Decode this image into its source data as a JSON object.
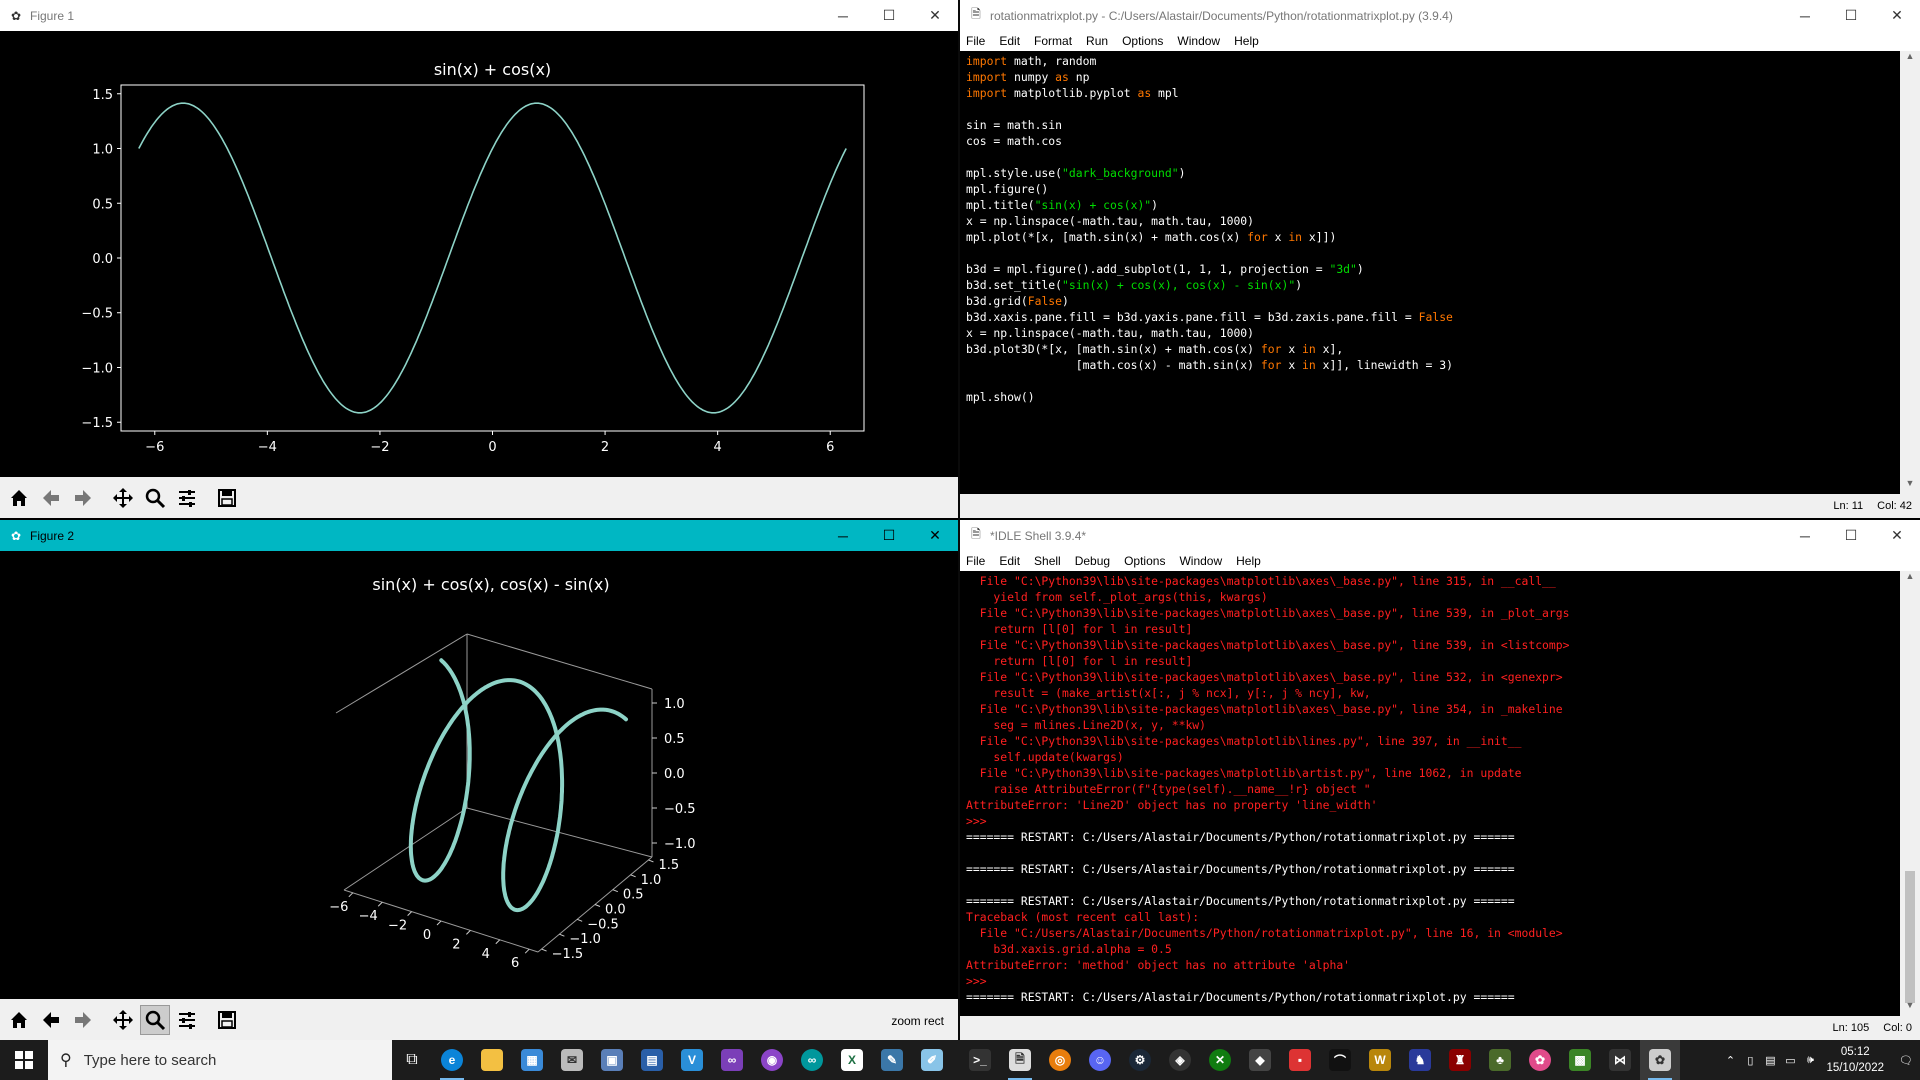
{
  "figure1": {
    "title": "Figure 1",
    "plot_title": "sin(x) + cos(x)",
    "x_ticks": [
      "−6",
      "−4",
      "−2",
      "0",
      "2",
      "4",
      "6"
    ],
    "y_ticks": [
      "1.5",
      "1.0",
      "0.5",
      "0.0",
      "−0.5",
      "−1.0",
      "−1.5"
    ],
    "line_color": "#8dd3c7"
  },
  "figure2": {
    "title": "Figure 2",
    "plot_title": "sin(x) + cos(x), cos(x) - sin(x)",
    "x_ticks": [
      "−6",
      "−4",
      "−2",
      "0",
      "2",
      "4",
      "6"
    ],
    "y_ticks": [
      "1.5",
      "1.0",
      "0.5",
      "0.0",
      "−0.5",
      "−1.0",
      "−1.5"
    ],
    "z_ticks": [
      "1.0",
      "0.5",
      "0.0",
      "−0.5",
      "−1.0"
    ],
    "status": "zoom rect"
  },
  "chart_data": [
    {
      "type": "line",
      "title": "sin(x) + cos(x)",
      "xlim": [
        -6.283,
        6.283
      ],
      "ylim": [
        -1.5,
        1.5
      ],
      "grid": false,
      "x": [
        -6.283,
        -5.498,
        -4.712,
        -3.927,
        -3.142,
        -2.356,
        -1.571,
        -0.785,
        0,
        0.785,
        1.571,
        2.356,
        3.142,
        3.927,
        4.712,
        5.498,
        6.283
      ],
      "series": [
        {
          "values": [
            1.0,
            1.414,
            1.0,
            0.0,
            -1.0,
            -1.414,
            -1.0,
            0.0,
            1.0,
            1.414,
            1.0,
            0.0,
            -1.0,
            -1.414,
            -1.0,
            0.0,
            1.0
          ]
        }
      ]
    },
    {
      "type": "line",
      "title": "sin(x) + cos(x), cos(x) - sin(x)",
      "grid": false,
      "x": [
        -6.283,
        -4.712,
        -3.142,
        -1.571,
        0,
        1.571,
        3.142,
        4.712,
        6.283
      ],
      "y": [
        1.0,
        1.0,
        -1.0,
        -1.0,
        1.0,
        1.0,
        -1.0,
        -1.0,
        1.0
      ],
      "z": [
        1.0,
        -1.0,
        -1.0,
        1.0,
        1.0,
        -1.0,
        -1.0,
        1.0,
        1.0
      ],
      "xlim": [
        -6.283,
        6.283
      ],
      "ylim": [
        -1.5,
        1.5
      ],
      "zlim": [
        -1.0,
        1.0
      ]
    }
  ],
  "editor": {
    "title": "rotationmatrixplot.py - C:/Users/Alastair/Documents/Python/rotationmatrixplot.py (3.9.4)",
    "menu": [
      "File",
      "Edit",
      "Format",
      "Run",
      "Options",
      "Window",
      "Help"
    ],
    "status_line": "Ln: 11",
    "status_col": "Col: 42"
  },
  "shell": {
    "title": "*IDLE Shell 3.9.4*",
    "menu": [
      "File",
      "Edit",
      "Shell",
      "Debug",
      "Options",
      "Window",
      "Help"
    ],
    "status_line": "Ln: 105",
    "status_col": "Col: 0"
  },
  "taskbar": {
    "search_placeholder": "Type here to search",
    "time": "05:12",
    "date": "15/10/2022"
  }
}
